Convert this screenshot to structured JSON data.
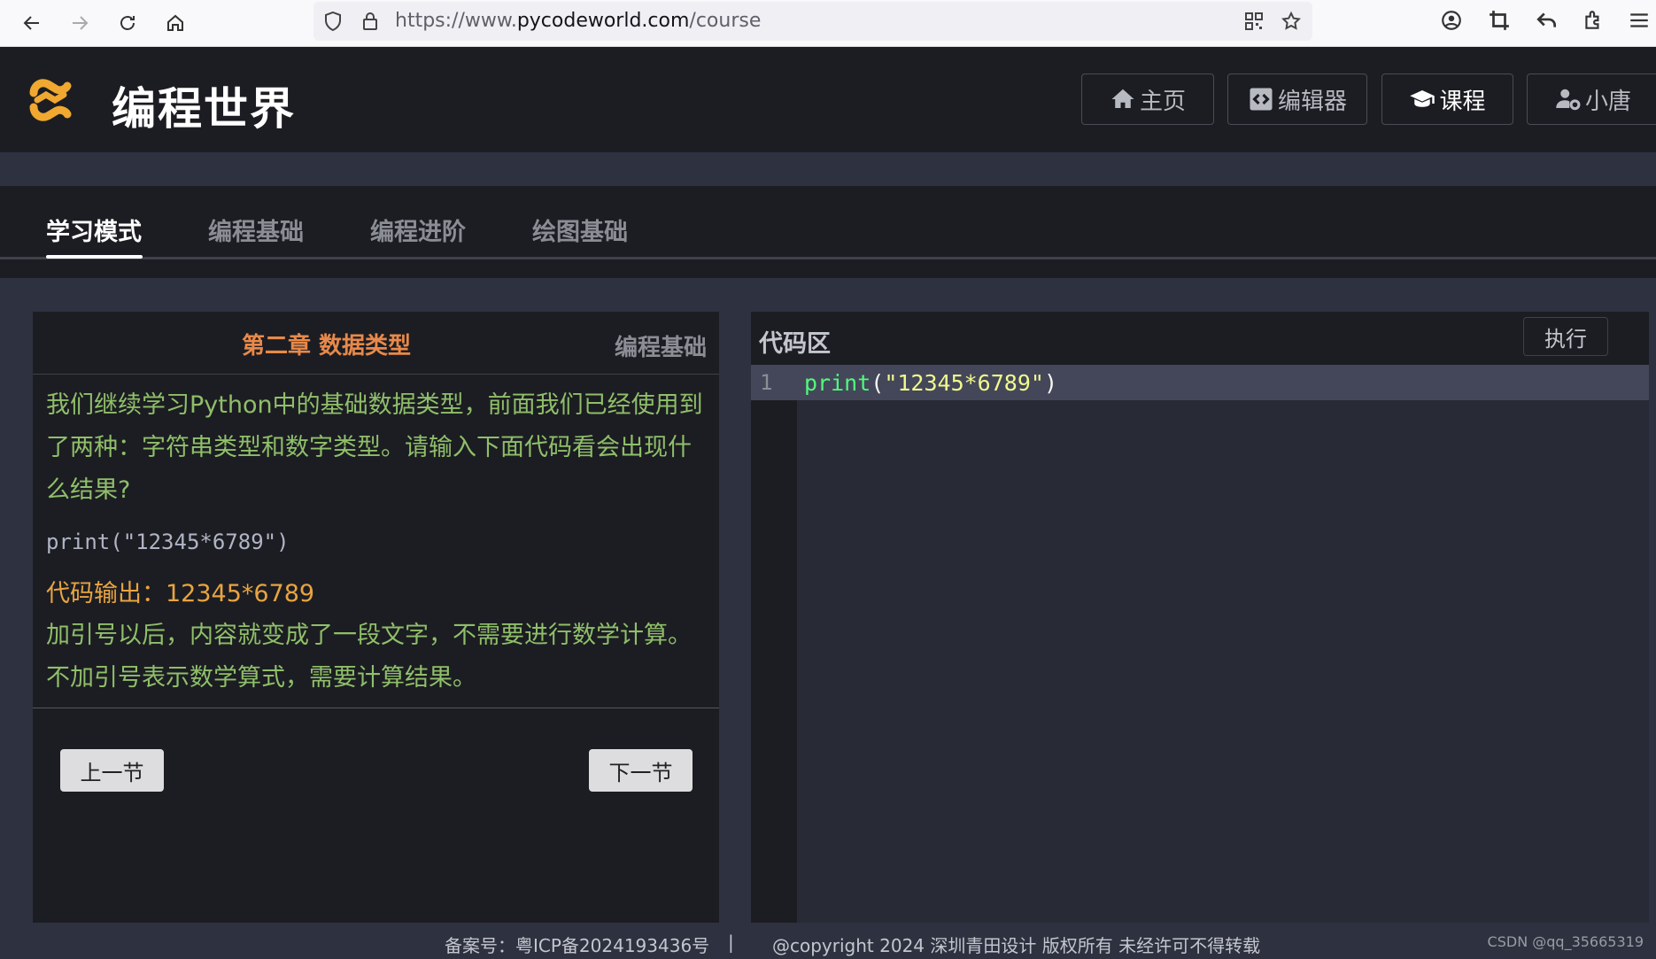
{
  "browser": {
    "url_prefix": "https://www.",
    "url_host": "pycodeworld.com",
    "url_path": "/course"
  },
  "site": {
    "title": "编程世界",
    "nav": [
      {
        "label": "主页",
        "icon": "home-icon"
      },
      {
        "label": "编辑器",
        "icon": "code-icon"
      },
      {
        "label": "课程",
        "icon": "graduation-cap-icon"
      },
      {
        "label": "小唐",
        "icon": "user-gear-icon"
      }
    ]
  },
  "tabs": [
    "学习模式",
    "编程基础",
    "编程进阶",
    "绘图基础"
  ],
  "lesson": {
    "chapter": "第二章 数据类型",
    "category": "编程基础",
    "intro": "我们继续学习Python中的基础数据类型，前面我们已经使用到了两种：字符串类型和数字类型。请输入下面代码看会出现什么结果?",
    "code_sample": "print(\"12345*6789\")",
    "output": "代码输出：12345*6789",
    "explanation_1": "加引号以后，内容就变成了一段文字，不需要进行数学计算。",
    "explanation_2": "不加引号表示数学算式，需要计算结果。",
    "prev_label": "上一节",
    "next_label": "下一节"
  },
  "editor": {
    "title": "代码区",
    "run_label": "执行",
    "line_number": "1",
    "code_fn": "print",
    "code_open": "(",
    "code_str": "\"12345*6789\"",
    "code_close": ")"
  },
  "footer": {
    "icp": "备案号：粤ICP备2024193436号",
    "separator": "|",
    "copyright": "@copyright 2024 深圳青田设计 版权所有 未经许可不得转载",
    "watermark": "CSDN @qq_35665319"
  },
  "colors": {
    "chapter": "#e8894a",
    "lesson_text": "#8fbf6a",
    "output": "#e8a441"
  }
}
